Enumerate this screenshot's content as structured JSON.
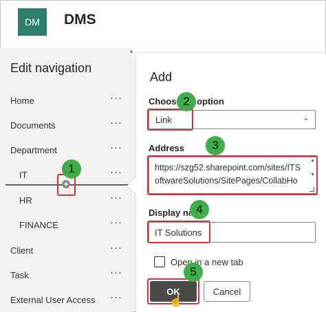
{
  "header": {
    "logo_text": "DM",
    "site_title": "DMS"
  },
  "nav": {
    "heading": "Edit navigation",
    "more_glyph": "···",
    "items": [
      {
        "label": "Home"
      },
      {
        "label": "Documents"
      },
      {
        "label": "Department"
      },
      {
        "label": "IT"
      },
      {
        "label": "HR"
      },
      {
        "label": "FINANCE"
      },
      {
        "label": "Client"
      },
      {
        "label": "Task"
      },
      {
        "label": "External User Access"
      }
    ],
    "insert_button_glyph": "+"
  },
  "add_panel": {
    "title": "Add",
    "choose_option_label": "Choose an option",
    "choose_option_value": "Link",
    "address_label": "Address",
    "address_line1": "https://szg52.sharepoint.com/sites/ITS",
    "address_line2": "oftwareSolutions/SitePages/CollabHo",
    "display_name_label": "Display name",
    "display_name_value": "IT Solutions",
    "open_new_tab_label": "Open in a new tab",
    "open_new_tab_checked": false,
    "ok_label": "OK",
    "cancel_label": "Cancel"
  },
  "annotations": {
    "step1": "1",
    "step2": "2",
    "step3": "3",
    "step4": "4",
    "step5": "5"
  },
  "colors": {
    "logo_bg": "#2e7d6e",
    "highlight": "#d13438",
    "badge": "#3fae49",
    "ok_button": "#4a4a4a"
  },
  "icons": {
    "chevron": "chevron-down-icon",
    "more": "more-icon",
    "cursor": "hand-pointer-icon"
  }
}
